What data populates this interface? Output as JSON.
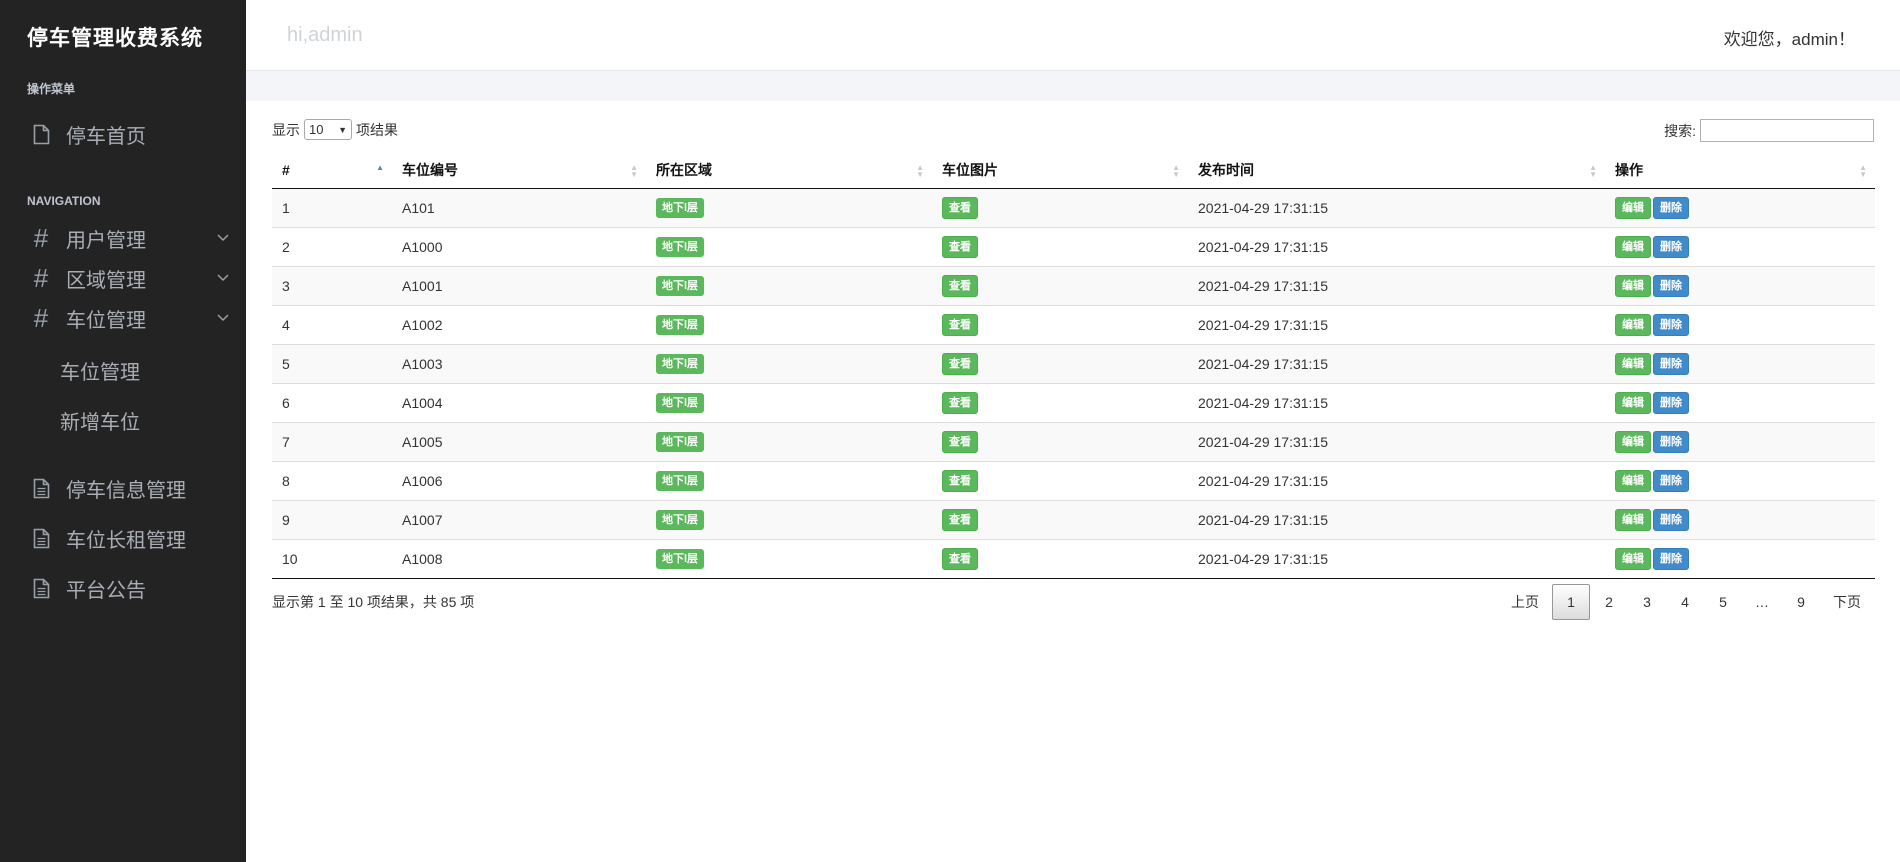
{
  "sidebar": {
    "brand": "停车管理收费系统",
    "section1": "操作菜单",
    "home": "停车首页",
    "section2": "NAVIGATION",
    "groups": [
      {
        "label": "用户管理"
      },
      {
        "label": "区域管理"
      },
      {
        "label": "车位管理"
      }
    ],
    "subitems": [
      "车位管理",
      "新增车位"
    ],
    "items": [
      {
        "label": "停车信息管理"
      },
      {
        "label": "车位长租管理"
      },
      {
        "label": "平台公告"
      }
    ]
  },
  "header": {
    "greeting": "hi,admin",
    "welcome": "欢迎您，admin！"
  },
  "table": {
    "length_prefix": "显示",
    "length_value": "10",
    "length_suffix": "项结果",
    "search_label": "搜索:",
    "search_value": "",
    "columns": [
      "#",
      "车位编号",
      "所在区域",
      "车位图片",
      "发布时间",
      "操作"
    ],
    "rows": [
      {
        "num": "1",
        "code": "A101",
        "area": "地下l层",
        "img": "查看",
        "time": "2021-04-29 17:31:15",
        "edit": "编辑",
        "del": "删除"
      },
      {
        "num": "2",
        "code": "A1000",
        "area": "地下l层",
        "img": "查看",
        "time": "2021-04-29 17:31:15",
        "edit": "编辑",
        "del": "删除"
      },
      {
        "num": "3",
        "code": "A1001",
        "area": "地下l层",
        "img": "查看",
        "time": "2021-04-29 17:31:15",
        "edit": "编辑",
        "del": "删除"
      },
      {
        "num": "4",
        "code": "A1002",
        "area": "地下l层",
        "img": "查看",
        "time": "2021-04-29 17:31:15",
        "edit": "编辑",
        "del": "删除"
      },
      {
        "num": "5",
        "code": "A1003",
        "area": "地下l层",
        "img": "查看",
        "time": "2021-04-29 17:31:15",
        "edit": "编辑",
        "del": "删除"
      },
      {
        "num": "6",
        "code": "A1004",
        "area": "地下l层",
        "img": "查看",
        "time": "2021-04-29 17:31:15",
        "edit": "编辑",
        "del": "删除"
      },
      {
        "num": "7",
        "code": "A1005",
        "area": "地下l层",
        "img": "查看",
        "time": "2021-04-29 17:31:15",
        "edit": "编辑",
        "del": "删除"
      },
      {
        "num": "8",
        "code": "A1006",
        "area": "地下l层",
        "img": "查看",
        "time": "2021-04-29 17:31:15",
        "edit": "编辑",
        "del": "删除"
      },
      {
        "num": "9",
        "code": "A1007",
        "area": "地下l层",
        "img": "查看",
        "time": "2021-04-29 17:31:15",
        "edit": "编辑",
        "del": "删除"
      },
      {
        "num": "10",
        "code": "A1008",
        "area": "地下l层",
        "img": "查看",
        "time": "2021-04-29 17:31:15",
        "edit": "编辑",
        "del": "删除"
      }
    ],
    "info": "显示第 1 至 10 项结果，共 85 项",
    "pager": {
      "prev": "上页",
      "pages": [
        "1",
        "2",
        "3",
        "4",
        "5",
        "…",
        "9"
      ],
      "next": "下页",
      "current": "1"
    }
  },
  "colors": {
    "sidebar_bg": "#232323",
    "label_green": "#5cb85c",
    "button_blue": "#428bca"
  },
  "icons": {
    "home": "file-icon",
    "group": "hash-icon",
    "expand": "chevron-down-icon",
    "items": "document-icon"
  }
}
